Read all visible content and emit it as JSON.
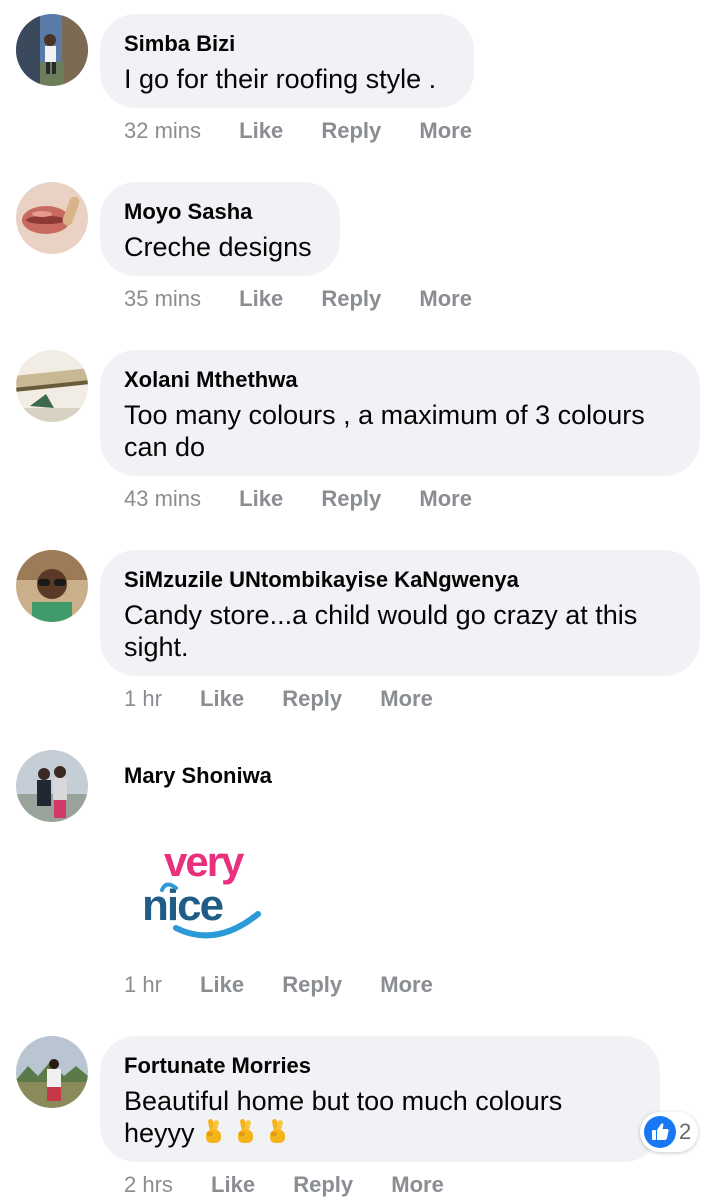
{
  "comments": [
    {
      "name": "Simba Bizi",
      "text": "I go for their roofing style .",
      "time": "32 mins",
      "like": "Like",
      "reply": "Reply",
      "more": "More"
    },
    {
      "name": "Moyo Sasha",
      "text": "Creche designs",
      "time": "35 mins",
      "like": "Like",
      "reply": "Reply",
      "more": "More"
    },
    {
      "name": "Xolani Mthethwa",
      "text_line1": "Too many colours , a maximum of 3 colours",
      "text_line2": "can do",
      "time": "43 mins",
      "like": "Like",
      "reply": "Reply",
      "more": "More"
    },
    {
      "name": "SiMzuzile UNtombikayise KaNgwenya",
      "text_line1": "Candy store...a child would go crazy at this",
      "text_line2": "sight.",
      "time": "1 hr",
      "like": "Like",
      "reply": "Reply",
      "more": "More"
    },
    {
      "name": "Mary Shoniwa",
      "sticker_text_top": "very",
      "sticker_text_bottom": "nice",
      "time": "1 hr",
      "like": "Like",
      "reply": "Reply",
      "more": "More"
    },
    {
      "name": "Fortunate Morries",
      "text_line1": "Beautiful home but too much colours",
      "text_line2": "heyyy",
      "emoji": "crossed-fingers-icon",
      "emoji_count": 3,
      "reaction_icon": "like-icon",
      "reaction_count": "2",
      "time": "2 hrs",
      "like": "Like",
      "reply": "Reply",
      "more": "More"
    }
  ],
  "colors": {
    "bubble": "#f0f2f5",
    "name": "#050505",
    "meta": "#8a8d91",
    "like_blue": "#1877f2",
    "sticker_pink": "#e8307f",
    "sticker_blue": "#2b9ad6",
    "sticker_dark": "#1f5d86"
  }
}
